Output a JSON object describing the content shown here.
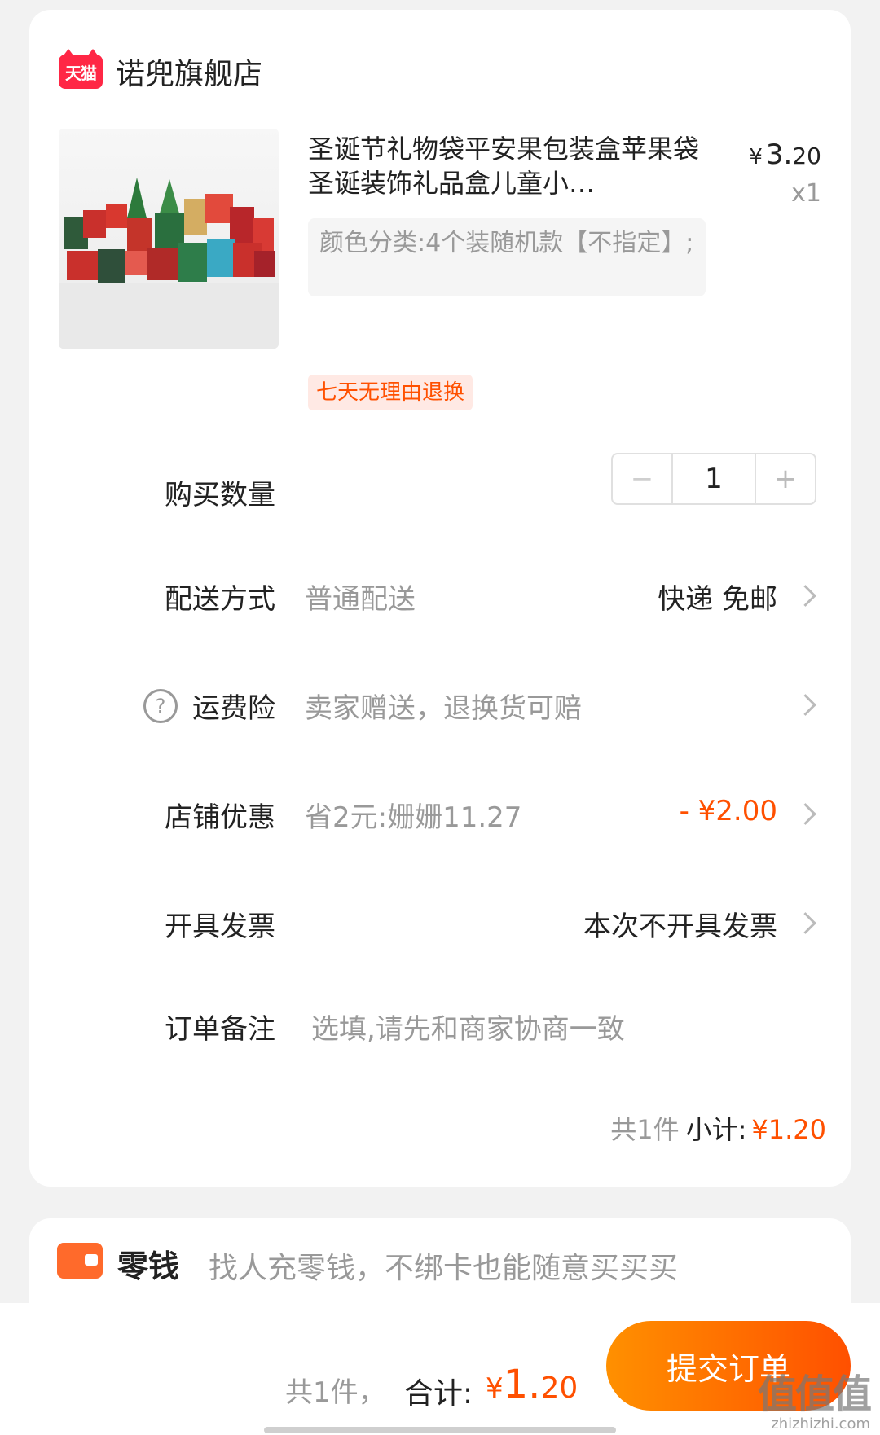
{
  "shop": {
    "badge": "天猫",
    "name": "诺兜旗舰店"
  },
  "product": {
    "title": "圣诞节礼物袋平安果包装盒苹果袋圣诞装饰礼品盒儿童小…",
    "price_symbol": "¥",
    "price_int": "3.",
    "price_dec": "20",
    "quantity": "x1",
    "sku": "颜色分类:4个装随机款【不指定】;",
    "return_tag": "七天无理由退换"
  },
  "quantity_row": {
    "label": "购买数量",
    "minus": "−",
    "value": "1",
    "plus": "+"
  },
  "delivery": {
    "label": "配送方式",
    "value": "普通配送",
    "right": "快递 免邮"
  },
  "insurance": {
    "help_icon": "?",
    "label": "运费险",
    "value": "卖家赠送，退换货可赔"
  },
  "discount": {
    "label": "店铺优惠",
    "value": "省2元:姗姗11.27",
    "right": "- ¥2.00"
  },
  "invoice": {
    "label": "开具发票",
    "right": "本次不开具发票"
  },
  "note": {
    "label": "订单备注",
    "placeholder": "选填,请先和商家协商一致"
  },
  "subtotal": {
    "count": "共1件",
    "label": "小计:",
    "amount": "¥1.20"
  },
  "wallet": {
    "name": "零钱",
    "description": "找人充零钱，不绑卡也能随意买买买"
  },
  "bottom_bar": {
    "count": "共1件，",
    "label": "合计:",
    "amount_symbol": "¥",
    "amount_int": "1.",
    "amount_dec": "20",
    "submit": "提交订单"
  },
  "watermark": {
    "main": "值值值",
    "sub": "zhizhizhi.com"
  },
  "colors": {
    "accent": "#ff5000",
    "tmall_red": "#ff2745",
    "button_gradient_start": "#ff9000",
    "button_gradient_end": "#ff5000"
  }
}
